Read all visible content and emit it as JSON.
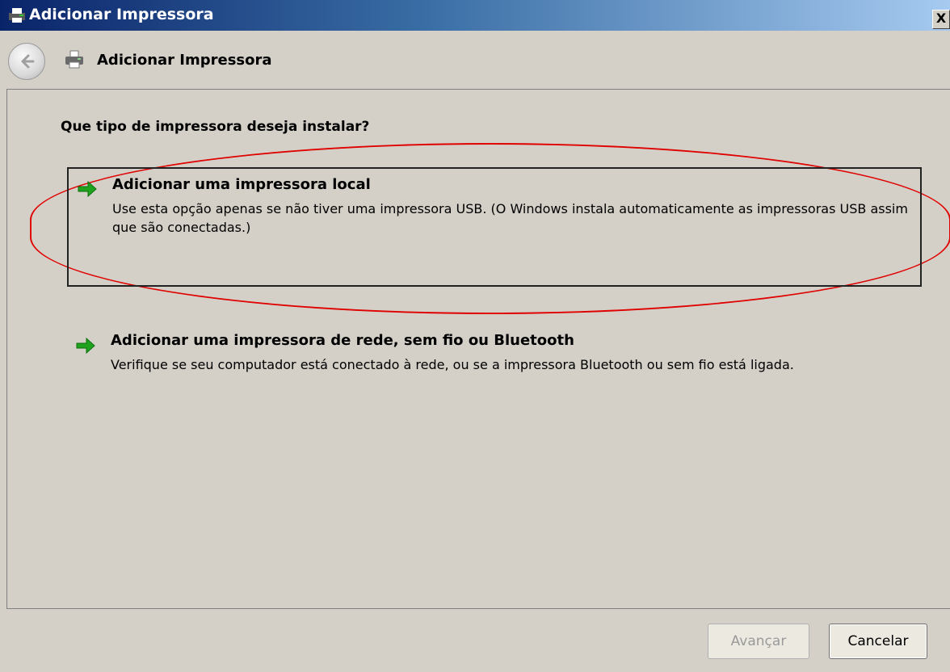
{
  "window": {
    "title": "Adicionar Impressora",
    "close_label": "X"
  },
  "nav": {
    "title": "Adicionar Impressora"
  },
  "main": {
    "question": "Que tipo de impressora deseja instalar?",
    "options": [
      {
        "title": "Adicionar uma impressora local",
        "description": "Use esta opção apenas se não tiver uma impressora USB. (O Windows instala automaticamente as impressoras USB assim que são conectadas.)",
        "selected": true
      },
      {
        "title": "Adicionar uma impressora de rede, sem fio ou Bluetooth",
        "description": "Verifique se seu computador está conectado à rede, ou se a impressora Bluetooth ou sem fio está ligada.",
        "selected": false
      }
    ]
  },
  "footer": {
    "next_label": "Avançar",
    "next_enabled": false,
    "cancel_label": "Cancelar"
  },
  "colors": {
    "highlight_ring": "#e00000",
    "arrow_green": "#1fa31f",
    "title_bar_start": "#0a246a"
  }
}
